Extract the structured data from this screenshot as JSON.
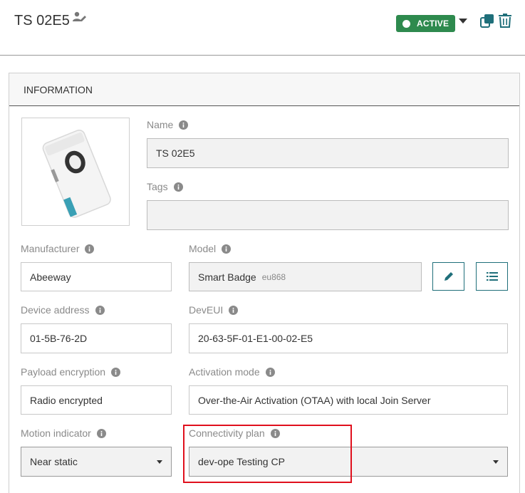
{
  "header": {
    "device_name": "TS 02E5",
    "status": "ACTIVE"
  },
  "card": {
    "title": "INFORMATION"
  },
  "fields": {
    "name": {
      "label": "Name",
      "value": "TS 02E5"
    },
    "tags": {
      "label": "Tags",
      "value": ""
    },
    "manufacturer": {
      "label": "Manufacturer",
      "value": "Abeeway"
    },
    "model": {
      "label": "Model",
      "value": "Smart Badge",
      "sub": "eu868"
    },
    "device_address": {
      "label": "Device address",
      "value": "01-5B-76-2D"
    },
    "deveui": {
      "label": "DevEUI",
      "value": "20-63-5F-01-E1-00-02-E5"
    },
    "payload_encryption": {
      "label": "Payload encryption",
      "value": "Radio encrypted"
    },
    "activation_mode": {
      "label": "Activation mode",
      "value": "Over-the-Air Activation (OTAA) with local Join Server"
    },
    "motion_indicator": {
      "label": "Motion indicator",
      "value": "Near static"
    },
    "connectivity_plan": {
      "label": "Connectivity plan",
      "value": "dev-ope Testing CP"
    }
  },
  "colors": {
    "status_green": "#2e8a4e",
    "accent_teal": "#1f6f7a",
    "highlight_red": "#e0101d"
  },
  "icons": [
    "edit-owner-icon",
    "status-dot-icon",
    "chevron-down-icon",
    "copy-icon",
    "trash-icon",
    "info-icon",
    "pencil-icon",
    "list-icon"
  ]
}
